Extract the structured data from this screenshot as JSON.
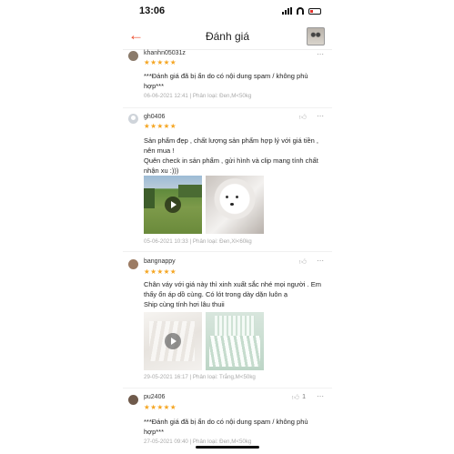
{
  "status_bar": {
    "time": "13:06"
  },
  "header": {
    "title": "Đánh giá",
    "back_icon": "arrow-left-icon",
    "accent": "#ee4d2d"
  },
  "reviews": [
    {
      "username": "khanhn05031z",
      "stars": "★★★★★",
      "likes": "",
      "content": "***Đánh giá đã bị ẩn do có nội dung spam / không phù hợp***",
      "meta": "06-06-2021 12:41 | Phân loại: Đen,M<50kg"
    },
    {
      "username": "gh0406",
      "stars": "★★★★★",
      "likes": "",
      "content": "Sản phẩm đẹp , chất lượng sản phẩm hợp lý với giá tiền , nên mua !\nQuên check in sản phẩm , gửi hình và clip mang tính chất nhận xu :)))",
      "meta": "05-06-2021 10:33 | Phân loại: Đen,Xl<60kg"
    },
    {
      "username": "bangnappy",
      "stars": "★★★★★",
      "likes": "",
      "content": "Chân váy với giá này thì xinh xuất sắc nhé mọi người . Em thấy ổn áp dồ cùng. Có lót trong dày dặn luôn ạ\nShip cùng tính hơi lâu thuii",
      "meta": "29-05-2021 16:17 | Phân loại: Trắng,M<50kg"
    },
    {
      "username": "pu2406",
      "stars": "★★★★★",
      "likes": "1",
      "content": "***Đánh giá đã bị ẩn do có nội dung spam / không phù hợp***",
      "meta": "27-05-2021 09:40 | Phân loại: Đen,M<50kg"
    }
  ],
  "icons": {
    "like": "thumbs-up-icon",
    "more": "more-dots-icon",
    "star": "star-icon"
  },
  "colors": {
    "star": "#f5a623",
    "meta": "#aaaaaa"
  }
}
